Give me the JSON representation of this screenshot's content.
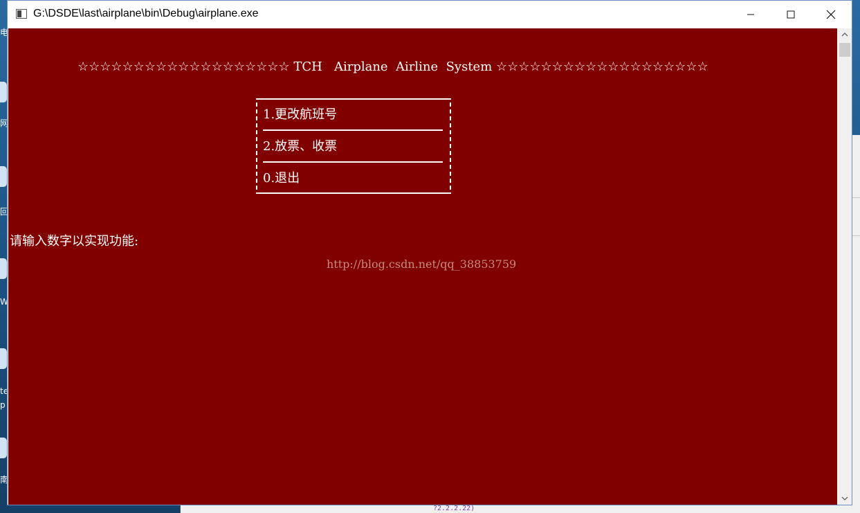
{
  "window": {
    "title": "G:\\DSDE\\last\\airplane\\bin\\Debug\\airplane.exe"
  },
  "console": {
    "banner": "☆☆☆☆☆☆☆☆☆☆☆☆☆☆☆☆☆☆☆ TCH   Airplane  Airline  System ☆☆☆☆☆☆☆☆☆☆☆☆☆☆☆☆☆☆☆",
    "menu": [
      {
        "label": "1.更改航班号"
      },
      {
        "label": "2.放票、收票"
      },
      {
        "label": "0.退出"
      }
    ],
    "prompt": "请输入数字以实现功能:",
    "background": "#800000",
    "foreground": "#ffffff"
  },
  "watermark": {
    "text": "http://blog.csdn.net/qq_38853759"
  },
  "desktop": {
    "icons": [
      {
        "label": "电"
      },
      {
        "label": "网"
      },
      {
        "label": "回"
      },
      {
        "label": "W"
      },
      {
        "label": "te"
      },
      {
        "label": "p"
      },
      {
        "label": "南"
      }
    ],
    "bottom_text": "?2.2.2.22)"
  },
  "icons": {
    "minimize": "minimize-icon",
    "maximize": "maximize-icon",
    "close": "close-icon",
    "scroll_up": "chevron-up-icon",
    "scroll_down": "chevron-down-icon"
  }
}
